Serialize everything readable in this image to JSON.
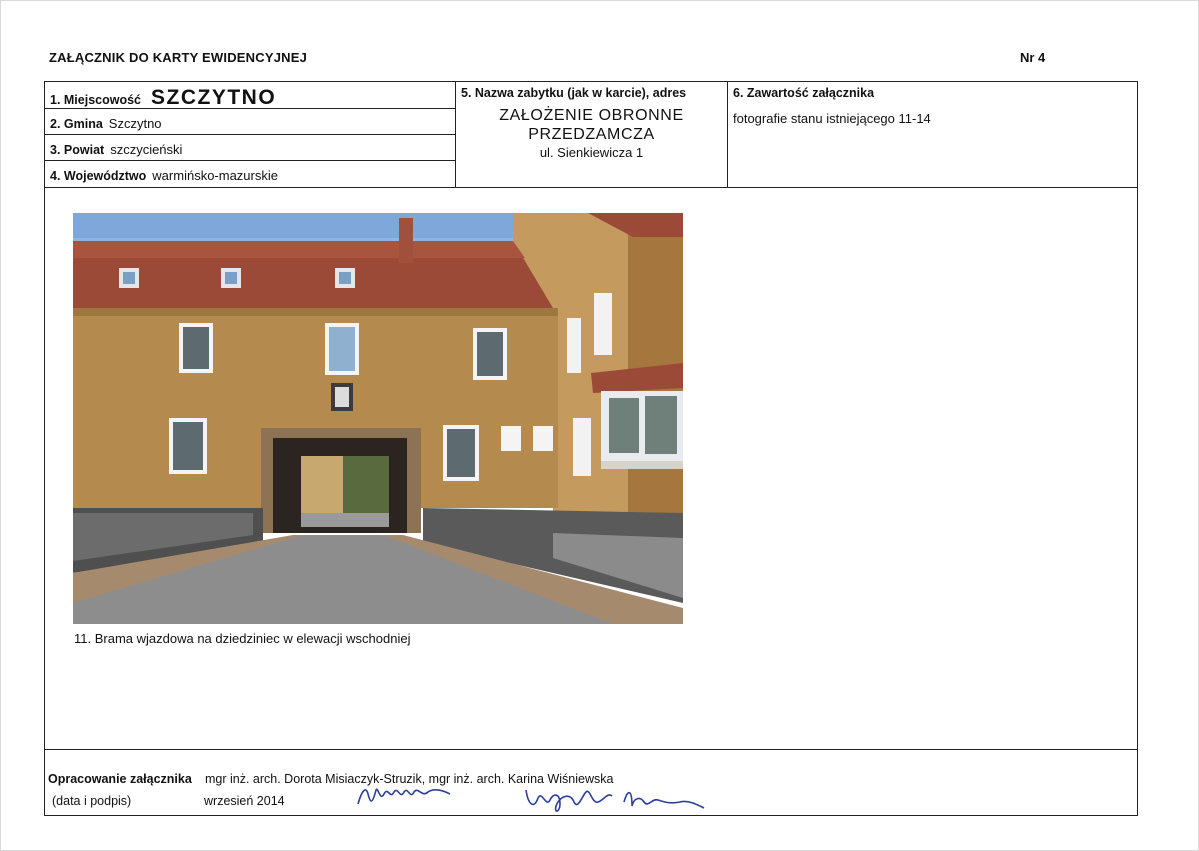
{
  "header": {
    "title": "ZAŁĄCZNIK DO KARTY EWIDENCYJNEJ",
    "number": "Nr 4"
  },
  "fields": {
    "miejscowosc": {
      "label": "1. Miejscowość",
      "value": "SZCZYTNO"
    },
    "gmina": {
      "label": "2. Gmina",
      "value": "Szczytno"
    },
    "powiat": {
      "label": "3. Powiat",
      "value": "szczycieński"
    },
    "wojewodztwo": {
      "label": "4. Województwo",
      "value": "warmińsko-mazurskie"
    },
    "nazwa": {
      "label": "5. Nazwa zabytku (jak w karcie), adres",
      "line1": "ZAŁOŻENIE OBRONNE",
      "line2": "PRZEDZAMCZA",
      "address": "ul. Sienkiewicza 1"
    },
    "zawartosc": {
      "label": "6. Zawartość załącznika",
      "value": "fotografie stanu istniejącego 11-14"
    }
  },
  "photo": {
    "caption": "11. Brama wjazdowa na dziedziniec w elewacji wschodniej"
  },
  "footer": {
    "label": "Opracowanie załącznika",
    "authors": "mgr inż. arch. Dorota Misiaczyk-Struzik, mgr inż. arch. Karina Wiśniewska",
    "sublabel": "(data i podpis)",
    "date": "wrzesień 2014"
  },
  "colors": {
    "wall": "#b48a4e",
    "roof": "#9c4a38",
    "sky": "#8fb4e0",
    "signature_ink": "#2c3f9a"
  }
}
